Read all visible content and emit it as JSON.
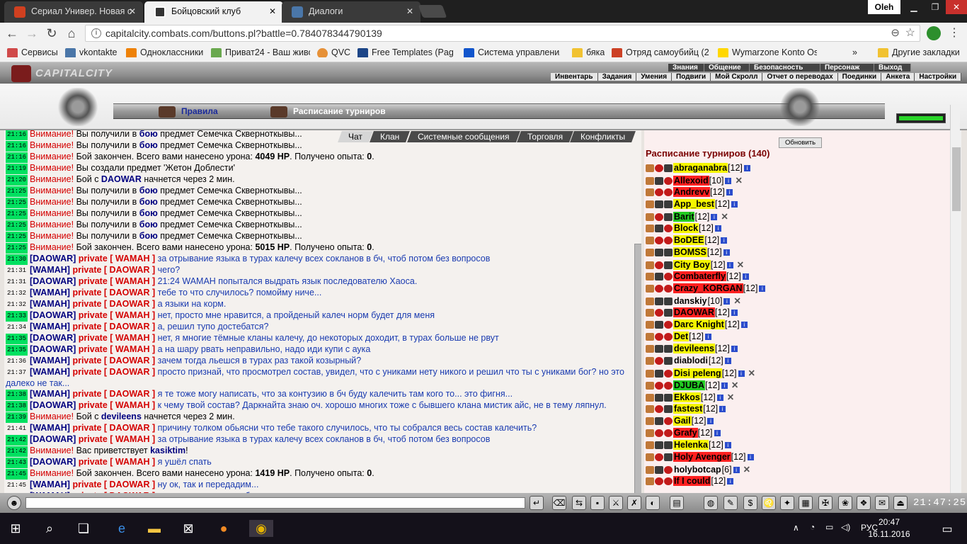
{
  "browser": {
    "tabs": [
      {
        "title": "Сериал Универ. Новая с",
        "favicon_color": "#d04020"
      },
      {
        "title": "Бойцовский клуб",
        "favicon_color": "#333333"
      },
      {
        "title": "Диалоги",
        "favicon_color": "#4a76a8"
      }
    ],
    "user": "Oleh",
    "url": "capitalcity.combats.com/buttons.pl?battle=0.784078344790139",
    "bookmarks": [
      {
        "label": "Сервисы",
        "icon_color": "#d04a4a"
      },
      {
        "label": "vkontakte",
        "icon_color": "#4a76a8"
      },
      {
        "label": "Одноклассники",
        "icon_color": "#ee8208"
      },
      {
        "label": "Приват24 - Ваш живо",
        "icon_color": "#6aa84f"
      },
      {
        "label": "QVC",
        "icon_color": "#e69138"
      },
      {
        "label": "Free Templates (Page",
        "icon_color": "#1c4587"
      },
      {
        "label": "Система управления",
        "icon_color": "#1155cc"
      },
      {
        "label": "бяка",
        "icon_color": "#f1c232"
      },
      {
        "label": "Отряд самоубийц (20",
        "icon_color": "#cc4125"
      },
      {
        "label": "Wymarzone Konto Os",
        "icon_color": "#ffd700"
      },
      {
        "label": "Другие закладки",
        "icon_color": "#f1c232"
      }
    ]
  },
  "game": {
    "logo": "CAPITALCITY",
    "menu_top": [
      "Знания",
      "Общение",
      "Безопасность",
      "Персонаж",
      "Выход"
    ],
    "menu_sub": [
      "Инвентарь",
      "Задания",
      "Умения",
      "Подвиги",
      "Мой Скролл",
      "Отчет о переводах",
      "Поединки",
      "Анкета",
      "Настройки"
    ],
    "link_rules": "Правила",
    "link_schedule": "Расписание турниров",
    "chat_tabs": [
      "Чат",
      "Клан",
      "Системные сообщения",
      "Торговля",
      "Конфликты"
    ],
    "chat": [
      {
        "t": "21:16",
        "g": true,
        "type": "sys",
        "parts": [
          [
            "w",
            "Внимание!"
          ],
          [
            "n",
            " Вы получили в "
          ],
          [
            "b",
            "бою"
          ],
          [
            "n",
            " предмет Семечка Скверноткывы..."
          ]
        ]
      },
      {
        "t": "21:16",
        "g": true,
        "type": "sys",
        "parts": [
          [
            "w",
            "Внимание!"
          ],
          [
            "n",
            " Вы получили в "
          ],
          [
            "b",
            "бою"
          ],
          [
            "n",
            " предмет Семечка Скверноткывы..."
          ]
        ]
      },
      {
        "t": "21:16",
        "g": true,
        "type": "sys",
        "parts": [
          [
            "w",
            "Внимание!"
          ],
          [
            "n",
            " Бой закончен. Всего вами нанесено урона: "
          ],
          [
            "k",
            "4049 HP"
          ],
          [
            "n",
            ". Получено опыта: "
          ],
          [
            "k",
            "0"
          ],
          [
            "n",
            "."
          ]
        ]
      },
      {
        "t": "21:19",
        "g": true,
        "type": "sys",
        "parts": [
          [
            "w",
            "Внимание!"
          ],
          [
            "n",
            " Вы создали предмет 'Жетон Доблести'"
          ]
        ]
      },
      {
        "t": "21:20",
        "g": true,
        "type": "sys",
        "parts": [
          [
            "w",
            "Внимание!"
          ],
          [
            "n",
            " Бой с "
          ],
          [
            "b",
            "DAOWAR"
          ],
          [
            "n",
            " начнется через 2 мин."
          ]
        ]
      },
      {
        "t": "21:25",
        "g": true,
        "type": "sys",
        "parts": [
          [
            "w",
            "Внимание!"
          ],
          [
            "n",
            " Вы получили в "
          ],
          [
            "b",
            "бою"
          ],
          [
            "n",
            " предмет Семечка Скверноткывы..."
          ]
        ]
      },
      {
        "t": "21:25",
        "g": true,
        "type": "sys",
        "parts": [
          [
            "w",
            "Внимание!"
          ],
          [
            "n",
            " Вы получили в "
          ],
          [
            "b",
            "бою"
          ],
          [
            "n",
            " предмет Семечка Скверноткывы..."
          ]
        ]
      },
      {
        "t": "21:25",
        "g": true,
        "type": "sys",
        "parts": [
          [
            "w",
            "Внимание!"
          ],
          [
            "n",
            " Вы получили в "
          ],
          [
            "b",
            "бою"
          ],
          [
            "n",
            " предмет Семечка Скверноткывы..."
          ]
        ]
      },
      {
        "t": "21:25",
        "g": true,
        "type": "sys",
        "parts": [
          [
            "w",
            "Внимание!"
          ],
          [
            "n",
            " Вы получили в "
          ],
          [
            "b",
            "бою"
          ],
          [
            "n",
            " предмет Семечка Скверноткывы..."
          ]
        ]
      },
      {
        "t": "21:25",
        "g": true,
        "type": "sys",
        "parts": [
          [
            "w",
            "Внимание!"
          ],
          [
            "n",
            " Вы получили в "
          ],
          [
            "b",
            "бою"
          ],
          [
            "n",
            " предмет Семечка Скверноткывы..."
          ]
        ]
      },
      {
        "t": "21:25",
        "g": true,
        "type": "sys",
        "parts": [
          [
            "w",
            "Внимание!"
          ],
          [
            "n",
            " Бой закончен. Всего вами нанесено урона: "
          ],
          [
            "k",
            "5015 HP"
          ],
          [
            "n",
            ". Получено опыта: "
          ],
          [
            "k",
            "0"
          ],
          [
            "n",
            "."
          ]
        ]
      },
      {
        "t": "21:30",
        "g": true,
        "from": "DAOWAR",
        "to": "WAMAH",
        "text": "за отрывание языка в турах калечу всех сокланов в бч, чтоб потом без вопросов"
      },
      {
        "t": "21:31",
        "g": false,
        "from": "WAMAH",
        "to": "DAOWAR",
        "text": "чего?"
      },
      {
        "t": "21:31",
        "g": false,
        "from": "DAOWAR",
        "to": "WAMAH",
        "text": "21:24 WAMAH попытался выдрать язык последователю Хаоса."
      },
      {
        "t": "21:32",
        "g": false,
        "from": "WAMAH",
        "to": "DAOWAR",
        "text": "тебе то что случилось? помойму ниче..."
      },
      {
        "t": "21:32",
        "g": false,
        "from": "WAMAH",
        "to": "DAOWAR",
        "text": "а языки на корм."
      },
      {
        "t": "21:33",
        "g": true,
        "from": "DAOWAR",
        "to": "WAMAH",
        "text": "нет, просто мне нравится, а пройденый калеч норм будет для меня"
      },
      {
        "t": "21:34",
        "g": false,
        "from": "WAMAH",
        "to": "DAOWAR",
        "text": "а, решил тупо достебатся?"
      },
      {
        "t": "21:35",
        "g": true,
        "from": "DAOWAR",
        "to": "WAMAH",
        "text": "нет, я многие тёмные кланы калечу, до некоторых доходит, в турах больше не рвут"
      },
      {
        "t": "21:35",
        "g": true,
        "from": "DAOWAR",
        "to": "WAMAH",
        "text": "а на шару рвать неправильно, надо иди купи с аука"
      },
      {
        "t": "21:36",
        "g": false,
        "from": "WAMAH",
        "to": "DAOWAR",
        "text": "зачем тогда льешся в турах раз такой козырный?"
      },
      {
        "t": "21:37",
        "g": false,
        "from": "WAMAH",
        "to": "DAOWAR",
        "text": "просто признай, что просмотрел состав, увидел, что с униками нету никого и решил что ты с униками бог? но это далеко не так...",
        "wrap": true
      },
      {
        "t": "21:38",
        "g": true,
        "from": "WAMAH",
        "to": "DAOWAR",
        "text": "я те тоже могу написать, что за контузию в бч буду калечить там кого то... это фигня..."
      },
      {
        "t": "21:38",
        "g": true,
        "from": "DAOWAR",
        "to": "WAMAH",
        "text": "к чему твой состав? Даркнайта знаю оч. хорошо многих тоже с бывшего клана мистик айс, не в тему ляпнул.",
        "wrap": true
      },
      {
        "t": "21:39",
        "g": true,
        "type": "sys",
        "parts": [
          [
            "w",
            "Внимание!"
          ],
          [
            "n",
            " Бой с "
          ],
          [
            "b",
            "devileens"
          ],
          [
            "n",
            " начнется через 2 мин."
          ]
        ]
      },
      {
        "t": "21:41",
        "g": false,
        "from": "WAMAH",
        "to": "DAOWAR",
        "text": "причину толком обьясни что тебе такого случилось, что ты собрался весь состав калечить?"
      },
      {
        "t": "21:42",
        "g": true,
        "from": "DAOWAR",
        "to": "WAMAH",
        "text": "за отрывание языка в турах калечу всех сокланов в бч, чтоб потом без вопросов"
      },
      {
        "t": "21:42",
        "g": true,
        "type": "sys",
        "parts": [
          [
            "w",
            "Внимание!"
          ],
          [
            "n",
            " Вас приветствует "
          ],
          [
            "b",
            "kasiktim"
          ],
          [
            "n",
            "!"
          ]
        ]
      },
      {
        "t": "21:43",
        "g": true,
        "from": "DAOWAR",
        "to": "WAMAH",
        "text": "я ушёл спать"
      },
      {
        "t": "21:45",
        "g": true,
        "type": "sys",
        "parts": [
          [
            "w",
            "Внимание!"
          ],
          [
            "n",
            " Бой закончен. Всего вами нанесено урона: "
          ],
          [
            "k",
            "1419 HP"
          ],
          [
            "n",
            ". Получено опыта: "
          ],
          [
            "k",
            "0"
          ],
          [
            "n",
            "."
          ]
        ]
      },
      {
        "t": "21:45",
        "g": false,
        "from": "WAMAH",
        "to": "DAOWAR",
        "text": "ну ок, так и передадим..."
      },
      {
        "t": "21:46",
        "g": false,
        "from": "WAMAH",
        "to": "DAOWAR",
        "text": "ну, чтою ответно тож бросали за слив в турнирах..."
      }
    ],
    "refresh_label": "Обновить",
    "schedule_title": "Расписание турниров (140)",
    "players": [
      {
        "name": "abraganabra",
        "lvl": "[12]",
        "bg": "#f5f500",
        "x": false
      },
      {
        "name": "Allexoid",
        "lvl": "[10]",
        "bg": "#ff2020",
        "x": true
      },
      {
        "name": "Andrevv",
        "lvl": "[12]",
        "bg": "#ff2020",
        "x": false
      },
      {
        "name": "App_best",
        "lvl": "[12]",
        "bg": "#f5f500",
        "x": false
      },
      {
        "name": "Barit",
        "lvl": "[12]",
        "bg": "#22cc22",
        "x": true
      },
      {
        "name": "Block",
        "lvl": "[12]",
        "bg": "#f5f500",
        "x": false
      },
      {
        "name": "BoDEE",
        "lvl": "[12]",
        "bg": "#f5f500",
        "x": false
      },
      {
        "name": "BOMSS",
        "lvl": "[12]",
        "bg": "#f5f500",
        "x": false
      },
      {
        "name": "City Boy",
        "lvl": "[12]",
        "bg": "#f5f500",
        "x": true
      },
      {
        "name": "Combaterfly",
        "lvl": "[12]",
        "bg": "#ff2020",
        "x": false
      },
      {
        "name": "Crazy_KORGAN",
        "lvl": "[12]",
        "bg": "#ff2020",
        "x": false
      },
      {
        "name": "danskiy",
        "lvl": "[10]",
        "bg": "transparent",
        "x": true
      },
      {
        "name": "DAOWAR",
        "lvl": "[12]",
        "bg": "#ff2020",
        "x": false
      },
      {
        "name": "Darc Knight",
        "lvl": "[12]",
        "bg": "#f5f500",
        "x": false
      },
      {
        "name": "Det",
        "lvl": "[12]",
        "bg": "#f5f500",
        "x": false
      },
      {
        "name": "devileens",
        "lvl": "[12]",
        "bg": "#f5f500",
        "x": false
      },
      {
        "name": "diablodi",
        "lvl": "[12]",
        "bg": "transparent",
        "x": false
      },
      {
        "name": "Disi peleng",
        "lvl": "[12]",
        "bg": "#f5f500",
        "x": true
      },
      {
        "name": "DJUBA",
        "lvl": "[12]",
        "bg": "#22cc22",
        "x": true
      },
      {
        "name": "Ekkos",
        "lvl": "[12]",
        "bg": "#f5f500",
        "x": true
      },
      {
        "name": "fastest",
        "lvl": "[12]",
        "bg": "#f5f500",
        "x": false
      },
      {
        "name": "Gail",
        "lvl": "[12]",
        "bg": "#f5f500",
        "x": false
      },
      {
        "name": "Grafy",
        "lvl": "[12]",
        "bg": "#ff2020",
        "x": false
      },
      {
        "name": "Helenka",
        "lvl": "[12]",
        "bg": "#f5f500",
        "x": false
      },
      {
        "name": "Holy Avenger",
        "lvl": "[12]",
        "bg": "#ff2020",
        "x": false
      },
      {
        "name": "holybotcap",
        "lvl": "[6]",
        "bg": "transparent",
        "x": true
      },
      {
        "name": "If I could",
        "lvl": "[12]",
        "bg": "#ff2020",
        "x": false
      }
    ],
    "clock": "21:47:25"
  },
  "taskbar": {
    "lang": "РУС",
    "time": "20:47",
    "date": "16.11.2016"
  }
}
